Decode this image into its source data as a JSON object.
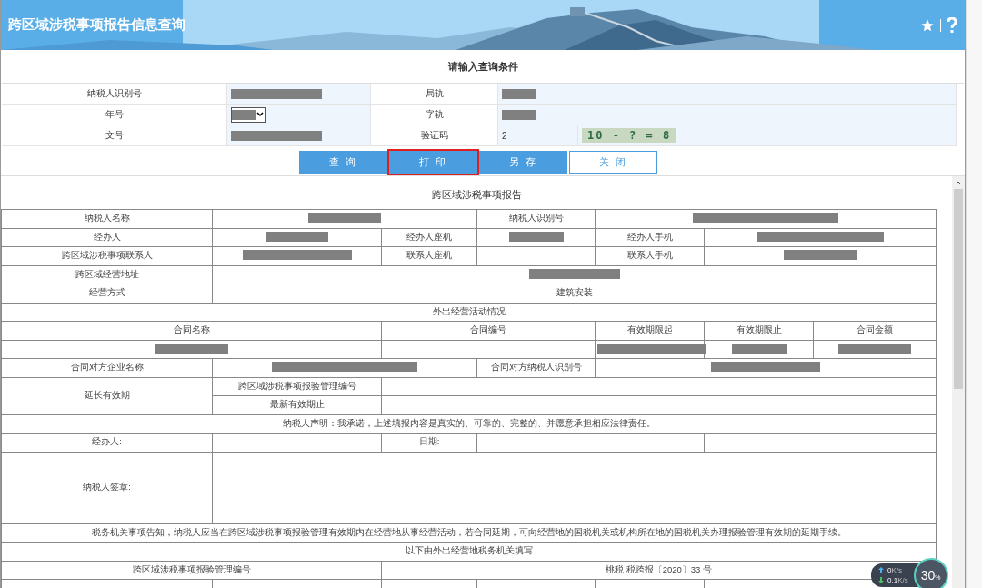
{
  "header": {
    "title": "跨区域涉税事项报告信息查询"
  },
  "query": {
    "title": "请输入查询条件",
    "rows": [
      {
        "cells": [
          {
            "kind": "label",
            "text": "纳税人识别号"
          },
          {
            "kind": "redacted"
          },
          {
            "kind": "label",
            "text": "局轨"
          },
          {
            "kind": "redacted"
          }
        ]
      },
      {
        "cells": [
          {
            "kind": "label",
            "text": "年号"
          },
          {
            "kind": "select"
          },
          {
            "kind": "label",
            "text": "字轨"
          },
          {
            "kind": "redacted"
          }
        ]
      },
      {
        "cells": [
          {
            "kind": "label",
            "text": "文号"
          },
          {
            "kind": "redacted"
          },
          {
            "kind": "label",
            "text": "验证码"
          },
          {
            "kind": "input",
            "text": "2"
          },
          {
            "kind": "captcha",
            "text": "10 - ? = 8"
          }
        ]
      }
    ]
  },
  "buttons": [
    {
      "label": "查 询",
      "kind": "primary",
      "highlighted": false
    },
    {
      "label": "打 印",
      "kind": "primary",
      "highlighted": true
    },
    {
      "label": "另 存",
      "kind": "primary",
      "highlighted": false
    },
    {
      "label": "关 闭",
      "kind": "outline",
      "highlighted": false
    }
  ],
  "report": {
    "title": "跨区域涉税事项报告",
    "rows": [
      {
        "cells": [
          {
            "kind": "text",
            "text": "纳税人名称"
          },
          {
            "kind": "redacted",
            "colspan": 2
          },
          {
            "kind": "text",
            "text": "纳税人识别号"
          },
          {
            "kind": "redacted",
            "colspan": 3
          }
        ]
      },
      {
        "cells": [
          {
            "kind": "text",
            "text": "经办人"
          },
          {
            "kind": "redacted"
          },
          {
            "kind": "text",
            "text": "经办人座机"
          },
          {
            "kind": "redacted"
          },
          {
            "kind": "text",
            "text": "经办人手机"
          },
          {
            "kind": "redacted",
            "colspan": 2
          }
        ]
      },
      {
        "cells": [
          {
            "kind": "text",
            "text": "跨区域涉税事项联系人"
          },
          {
            "kind": "redacted"
          },
          {
            "kind": "text",
            "text": "联系人座机"
          },
          {
            "kind": "blank"
          },
          {
            "kind": "text",
            "text": "联系人手机"
          },
          {
            "kind": "redacted",
            "colspan": 2
          }
        ]
      },
      {
        "cells": [
          {
            "kind": "text",
            "text": "跨区域经营地址"
          },
          {
            "kind": "redacted",
            "colspan": 6
          }
        ]
      },
      {
        "cells": [
          {
            "kind": "text",
            "text": "经营方式"
          },
          {
            "kind": "text",
            "text": "建筑安装",
            "colspan": 6
          }
        ]
      },
      {
        "cells": [
          {
            "kind": "text",
            "text": "外出经营活动情况",
            "colspan": 7
          }
        ]
      },
      {
        "cells": [
          {
            "kind": "text",
            "text": "合同名称",
            "colspan": 2
          },
          {
            "kind": "text",
            "text": "合同编号",
            "colspan": 2
          },
          {
            "kind": "text",
            "text": "有效期限起"
          },
          {
            "kind": "text",
            "text": "有效期限止"
          },
          {
            "kind": "text",
            "text": "合同金额"
          }
        ]
      },
      {
        "cells": [
          {
            "kind": "redacted",
            "colspan": 2
          },
          {
            "kind": "blank",
            "colspan": 2
          },
          {
            "kind": "redacted"
          },
          {
            "kind": "redacted"
          },
          {
            "kind": "redacted"
          }
        ]
      },
      {
        "cells": [
          {
            "kind": "text",
            "text": "合同对方企业名称"
          },
          {
            "kind": "redacted",
            "colspan": 2
          },
          {
            "kind": "text",
            "text": "合同对方纳税人识别号"
          },
          {
            "kind": "redacted",
            "colspan": 3
          }
        ]
      },
      {
        "cells": [
          {
            "kind": "text",
            "text": "延长有效期",
            "rowspan": 2
          },
          {
            "kind": "text",
            "text": "跨区域涉税事项报验管理编号"
          },
          {
            "kind": "blank",
            "colspan": 5
          }
        ]
      },
      {
        "cells": [
          {
            "kind": "text",
            "text": "最新有效期止"
          },
          {
            "kind": "blank",
            "colspan": 5
          }
        ]
      },
      {
        "cells": [
          {
            "kind": "text",
            "text": "纳税人声明：我承诺，上述填报内容是真实的、可靠的、完整的、并愿意承担相应法律责任。",
            "colspan": 7
          }
        ]
      },
      {
        "cells": [
          {
            "kind": "text",
            "text": "经办人:"
          },
          {
            "kind": "blank"
          },
          {
            "kind": "text",
            "text": "日期:"
          },
          {
            "kind": "blank",
            "colspan": 2
          },
          {
            "kind": "blank",
            "colspan": 2
          }
        ]
      },
      {
        "cells": [
          {
            "kind": "text",
            "text": "纳税人签章:"
          },
          {
            "kind": "blank",
            "colspan": 6
          }
        ]
      },
      {
        "cells": [
          {
            "kind": "text",
            "text": "税务机关事项告知，纳税人应当在跨区域涉税事项报验管理有效期内在经营地从事经营活动，若合同延期，可向经营地的国税机关或机构所在地的国税机关办理报验管理有效期的延期手续。",
            "colspan": 7
          }
        ]
      },
      {
        "cells": [
          {
            "kind": "text",
            "text": "以下由外出经营地税务机关填写",
            "colspan": 7
          }
        ]
      },
      {
        "cells": [
          {
            "kind": "text",
            "text": "跨区域涉税事项报验管理编号",
            "colspan": 2
          },
          {
            "kind": "text",
            "text": "桃税 税跨报〔2020〕33 号",
            "colspan": 5
          }
        ]
      },
      {
        "cells": [
          {
            "kind": "blank"
          },
          {
            "kind": "blank"
          },
          {
            "kind": "blank"
          },
          {
            "kind": "blank"
          },
          {
            "kind": "blank"
          },
          {
            "kind": "blank",
            "colspan": 2
          }
        ]
      }
    ]
  },
  "net_widget": {
    "up": "0",
    "up_unit": "K/s",
    "down": "0.1",
    "down_unit": "K/s",
    "percent": "30",
    "percent_unit": "%"
  }
}
